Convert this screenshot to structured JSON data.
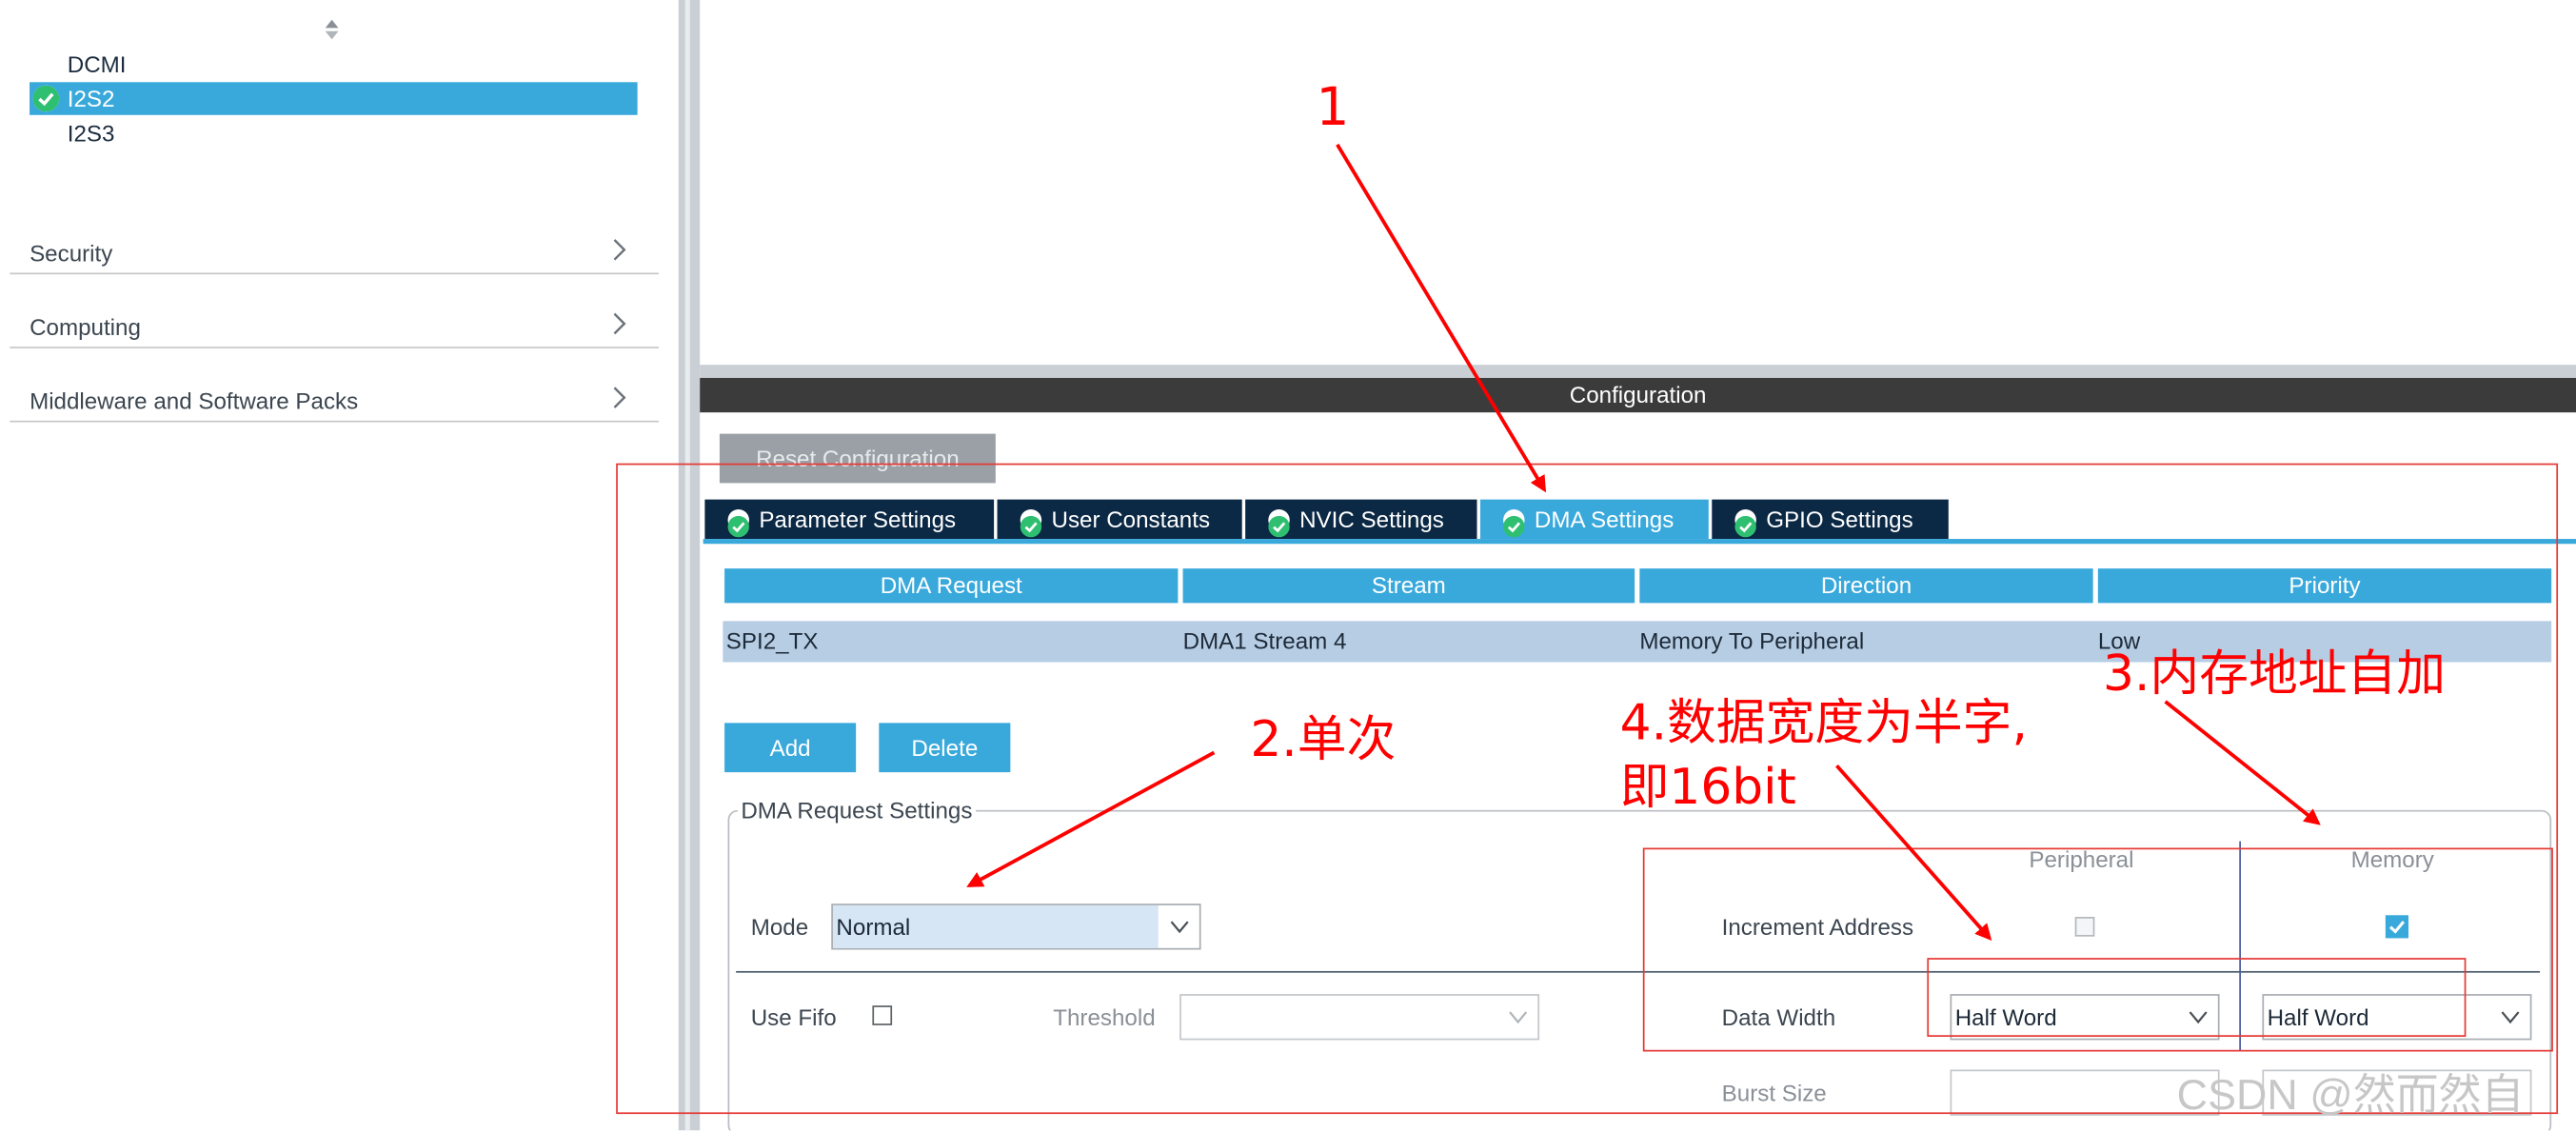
{
  "peripherals": {
    "items": [
      {
        "label": "DCMI",
        "selected": false
      },
      {
        "label": "I2S2",
        "selected": true,
        "icon": "check-circle-icon"
      },
      {
        "label": "I2S3",
        "selected": false
      }
    ]
  },
  "categories": [
    {
      "label": "Security"
    },
    {
      "label": "Computing"
    },
    {
      "label": "Middleware and Software Packs"
    }
  ],
  "config": {
    "header": "Configuration",
    "reset_label": "Reset Configuration",
    "tabs": [
      {
        "label": "Parameter Settings",
        "active": false
      },
      {
        "label": "User Constants",
        "active": false
      },
      {
        "label": "NVIC Settings",
        "active": false
      },
      {
        "label": "DMA Settings",
        "active": true
      },
      {
        "label": "GPIO Settings",
        "active": false
      }
    ]
  },
  "dma_table": {
    "headers": [
      "DMA Request",
      "Stream",
      "Direction",
      "Priority"
    ],
    "rows": [
      [
        "SPI2_TX",
        "DMA1 Stream 4",
        "Memory To Peripheral",
        "Low"
      ]
    ]
  },
  "buttons": {
    "add": "Add",
    "delete": "Delete"
  },
  "request_settings": {
    "title": "DMA Request Settings",
    "mode_label": "Mode",
    "mode_value": "Normal",
    "use_fifo_label": "Use Fifo",
    "use_fifo_checked": false,
    "threshold_label": "Threshold",
    "threshold_value": "",
    "peripheral_header": "Peripheral",
    "memory_header": "Memory",
    "increment_label": "Increment Address",
    "increment_peripheral": false,
    "increment_memory": true,
    "data_width_label": "Data Width",
    "data_width_peripheral": "Half Word",
    "data_width_memory": "Half Word",
    "burst_label": "Burst Size"
  },
  "annotations": {
    "a1": "1",
    "a2": "2.单次",
    "a3": "3.内存地址自加",
    "a4_line1": "4.数据宽度为半字,",
    "a4_line2": "即16bit"
  },
  "watermark": "CSDN @然而然自",
  "colors": {
    "accent": "#39a9dc",
    "annotation": "#ff0000",
    "tab_dark": "#0b2845"
  }
}
